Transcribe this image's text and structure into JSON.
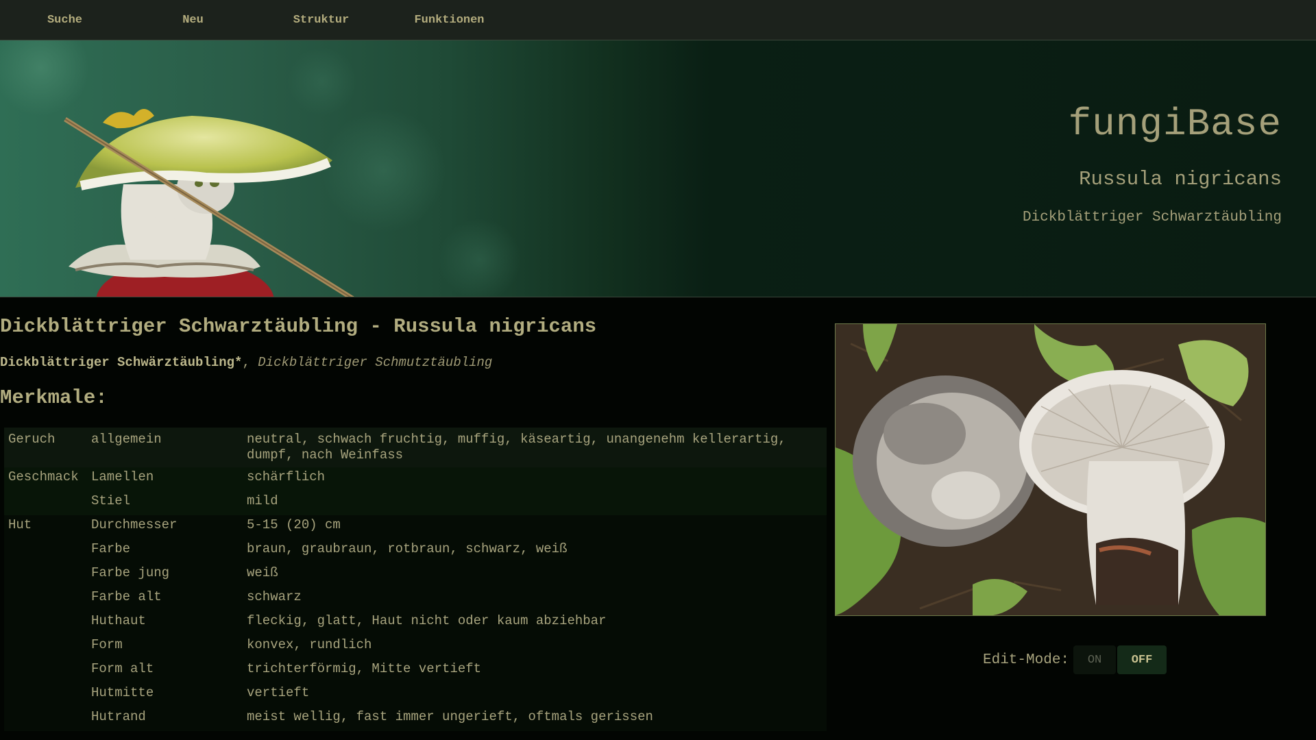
{
  "nav": {
    "items": [
      {
        "label": "Suche"
      },
      {
        "label": "Neu"
      },
      {
        "label": "Struktur"
      },
      {
        "label": "Funktionen"
      }
    ]
  },
  "header": {
    "site_title": "fungiBase",
    "scientific_name": "Russula nigricans",
    "common_name": "Dickblättriger Schwarztäubling"
  },
  "main": {
    "title": "Dickblättriger Schwarztäubling - Russula nigricans",
    "synonym_primary": "Dickblättriger Schwärztäubling*",
    "synonym_separator": ", ",
    "synonym_secondary": "Dickblättriger Schmutztäubling",
    "section_title": "Merkmale:"
  },
  "features": [
    {
      "group": "Geruch",
      "property": "allgemein",
      "value": "neutral, schwach fruchtig, muffig, käseartig, unangenehm kellerartig, dumpf, nach Weinfass"
    },
    {
      "group": "Geschmack",
      "property": "Lamellen",
      "value": "schärflich"
    },
    {
      "group": "",
      "property": "Stiel",
      "value": "mild"
    },
    {
      "group": "Hut",
      "property": "Durchmesser",
      "value": "5-15 (20) cm"
    },
    {
      "group": "",
      "property": "Farbe",
      "value": "braun, graubraun, rotbraun, schwarz, weiß"
    },
    {
      "group": "",
      "property": "Farbe jung",
      "value": "weiß"
    },
    {
      "group": "",
      "property": "Farbe alt",
      "value": "schwarz"
    },
    {
      "group": "",
      "property": "Huthaut",
      "value": "fleckig, glatt, Haut nicht oder kaum abziehbar"
    },
    {
      "group": "",
      "property": "Form",
      "value": "konvex, rundlich"
    },
    {
      "group": "",
      "property": "Form alt",
      "value": "trichterförmig, Mitte vertieft"
    },
    {
      "group": "",
      "property": "Hutmitte",
      "value": "vertieft"
    },
    {
      "group": "",
      "property": "Hutrand",
      "value": "meist wellig, fast immer ungerieft, oftmals gerissen"
    }
  ],
  "edit_mode": {
    "label": "Edit-Mode:",
    "on_label": "ON",
    "off_label": "OFF",
    "state": "OFF"
  }
}
